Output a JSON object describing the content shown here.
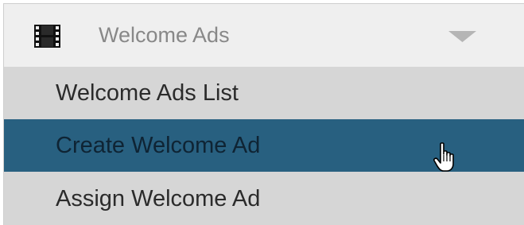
{
  "menu": {
    "header": {
      "icon": "film-icon",
      "label": "Welcome Ads",
      "expand_icon": "caret-down-icon"
    },
    "items": [
      {
        "label": "Welcome Ads List",
        "selected": false
      },
      {
        "label": "Create Welcome Ad",
        "selected": true
      },
      {
        "label": "Assign Welcome Ad",
        "selected": false
      }
    ]
  },
  "cursor": "hand-pointer-icon",
  "colors": {
    "header_bg": "#efefef",
    "item_bg": "#d6d6d6",
    "selected_bg": "#286080",
    "header_text": "#888888",
    "item_text": "#2b2b2b"
  }
}
